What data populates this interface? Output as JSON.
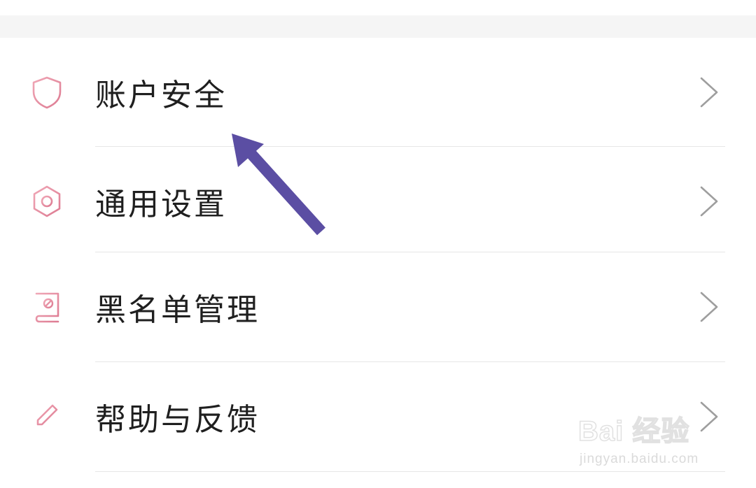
{
  "menu": {
    "items": [
      {
        "label": "账户安全",
        "icon": "shield-icon"
      },
      {
        "label": "通用设置",
        "icon": "gear-icon"
      },
      {
        "label": "黑名单管理",
        "icon": "blacklist-book-icon"
      },
      {
        "label": "帮助与反馈",
        "icon": "pencil-icon"
      }
    ]
  },
  "annotation": {
    "arrow_color": "#5b4ea3",
    "points_to": "账户安全"
  },
  "watermark": {
    "brand": "Bai 经验",
    "url": "jingyan.baidu.com"
  },
  "colors": {
    "icon_accent": "#e2849b",
    "chevron": "#9e9e9e",
    "section_gap": "#f5f5f5",
    "text": "#1f1f1f"
  }
}
